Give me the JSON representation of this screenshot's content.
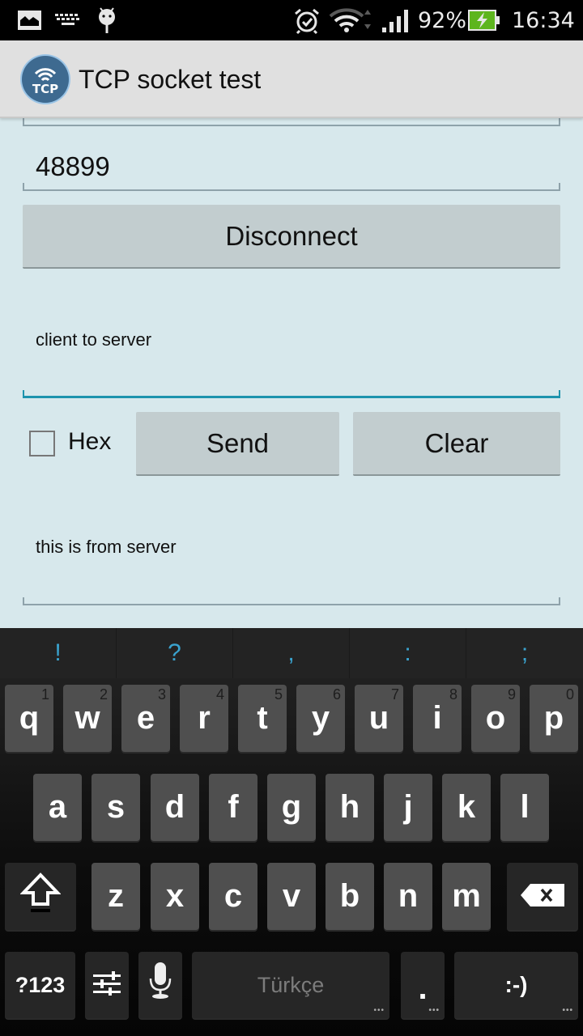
{
  "status_bar": {
    "left_icons": [
      "gallery-icon",
      "keyboard-icon",
      "android-debug-icon"
    ],
    "right_icons": [
      "alarm-icon",
      "wifi-icon",
      "signal-icon",
      "battery-charging-icon"
    ],
    "battery_percent": "92%",
    "time": "16:34",
    "battery_color": "#5db51e"
  },
  "action_bar": {
    "logo_text": "TCP",
    "title": "TCP socket test"
  },
  "form": {
    "host_value": "",
    "port_value": "48899",
    "disconnect_label": "Disconnect",
    "send_input_value": "client to server",
    "hex_label": "Hex",
    "hex_checked": false,
    "send_label": "Send",
    "clear_label": "Clear",
    "receive_value": "this is from server",
    "accent_color": "#1d93ad"
  },
  "keyboard": {
    "suggestions": [
      "!",
      "?",
      ",",
      ":",
      ";"
    ],
    "row1": [
      {
        "key": "q",
        "hint": "1"
      },
      {
        "key": "w",
        "hint": "2"
      },
      {
        "key": "e",
        "hint": "3"
      },
      {
        "key": "r",
        "hint": "4"
      },
      {
        "key": "t",
        "hint": "5"
      },
      {
        "key": "y",
        "hint": "6"
      },
      {
        "key": "u",
        "hint": "7"
      },
      {
        "key": "i",
        "hint": "8"
      },
      {
        "key": "o",
        "hint": "9"
      },
      {
        "key": "p",
        "hint": "0"
      }
    ],
    "row2": [
      "a",
      "s",
      "d",
      "f",
      "g",
      "h",
      "j",
      "k",
      "l"
    ],
    "row3": [
      "z",
      "x",
      "c",
      "v",
      "b",
      "n",
      "m"
    ],
    "shift_icon": "shift-icon",
    "backspace_icon": "backspace-icon",
    "symbols_label": "?123",
    "settings_icon": "settings-sliders-icon",
    "mic_icon": "microphone-icon",
    "space_label": "Türkçe",
    "period_label": ".",
    "emoji_label": ":-)",
    "more_dots": "•••",
    "suggestion_color": "#3aa3cf"
  }
}
